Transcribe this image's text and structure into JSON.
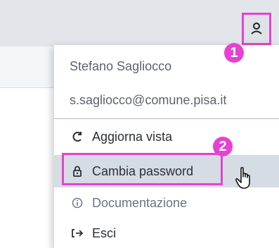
{
  "header": {
    "user_icon": "user-icon"
  },
  "menu": {
    "user_name": "Stefano Sagliocco",
    "user_email": "s.sagliocco@comune.pisa.it",
    "items": [
      {
        "label": "Aggiorna vista",
        "icon": "refresh-icon",
        "icon_glyph": "C"
      },
      {
        "label": "Cambia password",
        "icon": "lock-icon",
        "icon_glyph": "🔒"
      },
      {
        "label": "Documentazione",
        "icon": "info-icon",
        "icon_glyph": "ⓘ"
      },
      {
        "label": "Esci",
        "icon": "logout-icon",
        "icon_glyph": "[→"
      }
    ]
  },
  "annotations": {
    "step1": "1",
    "step2": "2"
  },
  "colors": {
    "annotation": "#e542d1",
    "highlight_row": "#d6dce3",
    "topbar": "#e2e6ea"
  }
}
